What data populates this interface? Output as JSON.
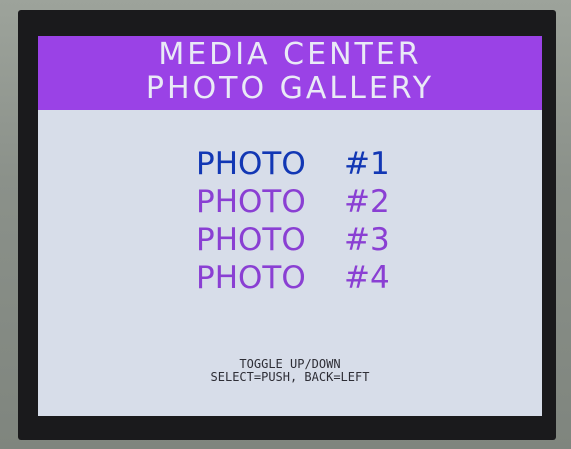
{
  "header": {
    "title_line1": "MEDIA CENTER",
    "title_line2": "PHOTO GALLERY"
  },
  "menu": {
    "items": [
      {
        "label": "PHOTO",
        "number": "#1",
        "selected": true
      },
      {
        "label": "PHOTO",
        "number": "#2",
        "selected": false
      },
      {
        "label": "PHOTO",
        "number": "#3",
        "selected": false
      },
      {
        "label": "PHOTO",
        "number": "#4",
        "selected": false
      }
    ]
  },
  "footer": {
    "line1": "TOGGLE UP/DOWN",
    "line2": "SELECT=PUSH, BACK=LEFT"
  },
  "colors": {
    "header_bg": "#9a42e6",
    "screen_bg": "#d7dde9",
    "selected_text": "#1237b4",
    "menu_text": "#8a3fd3"
  }
}
